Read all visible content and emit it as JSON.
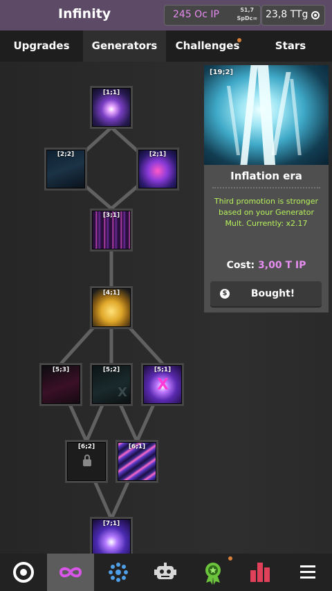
{
  "header": {
    "title": "Infinity",
    "ip_value": "245 Oc IP",
    "ip_rate_top": "51,7",
    "ip_rate_bottom": "SpDc∞",
    "tt_value": "23,8 TTg"
  },
  "tabs": [
    {
      "label": "Upgrades",
      "active": false
    },
    {
      "label": "Generators",
      "active": true
    },
    {
      "label": "Challenges",
      "active": false,
      "notification": true
    },
    {
      "label": "Stars",
      "active": false
    }
  ],
  "tree": {
    "nodes": [
      {
        "id": "[1;1]",
        "state": "bought",
        "art": "galaxy"
      },
      {
        "id": "[2;2]",
        "state": "dark",
        "art": "dark-wave"
      },
      {
        "id": "[2;1]",
        "state": "bought",
        "art": "cube"
      },
      {
        "id": "[3;1]",
        "state": "bought",
        "art": "rain"
      },
      {
        "id": "[4;1]",
        "state": "bought",
        "art": "coins"
      },
      {
        "id": "[5;3]",
        "state": "dark",
        "art": "dark-hand"
      },
      {
        "id": "[5;2]",
        "state": "dark",
        "art": "dark-x"
      },
      {
        "id": "[5;1]",
        "state": "bought",
        "art": "x-orbit"
      },
      {
        "id": "[6;2]",
        "state": "locked",
        "art": "lock"
      },
      {
        "id": "[6;1]",
        "state": "bought",
        "art": "streaks"
      },
      {
        "id": "[7;1]",
        "state": "bought",
        "art": "cards"
      }
    ]
  },
  "panel": {
    "node_id": "[19;2]",
    "name": "Inflation era",
    "description": "Third promotion is stronger based on your Generator Mult. Currently: x2.17",
    "cost_label": "Cost:",
    "cost_value": "3,00 T IP",
    "button_icon": "$",
    "button_label": "Bought!"
  },
  "bottom_nav": [
    {
      "icon": "target-icon",
      "active": false
    },
    {
      "icon": "infinity-icon",
      "active": true
    },
    {
      "icon": "dots-circle-icon",
      "active": false
    },
    {
      "icon": "robot-icon",
      "active": false
    },
    {
      "icon": "award-icon",
      "active": false,
      "notification": true
    },
    {
      "icon": "bar-chart-icon",
      "active": false
    },
    {
      "icon": "menu-icon",
      "active": false
    }
  ],
  "colors": {
    "header_bg": "#5c4a66",
    "ip_pink": "#e78bf0",
    "desc_green": "#b8f25c",
    "notification": "#d8803a",
    "stats_red": "#e0405a",
    "award_green": "#6cc43c"
  }
}
